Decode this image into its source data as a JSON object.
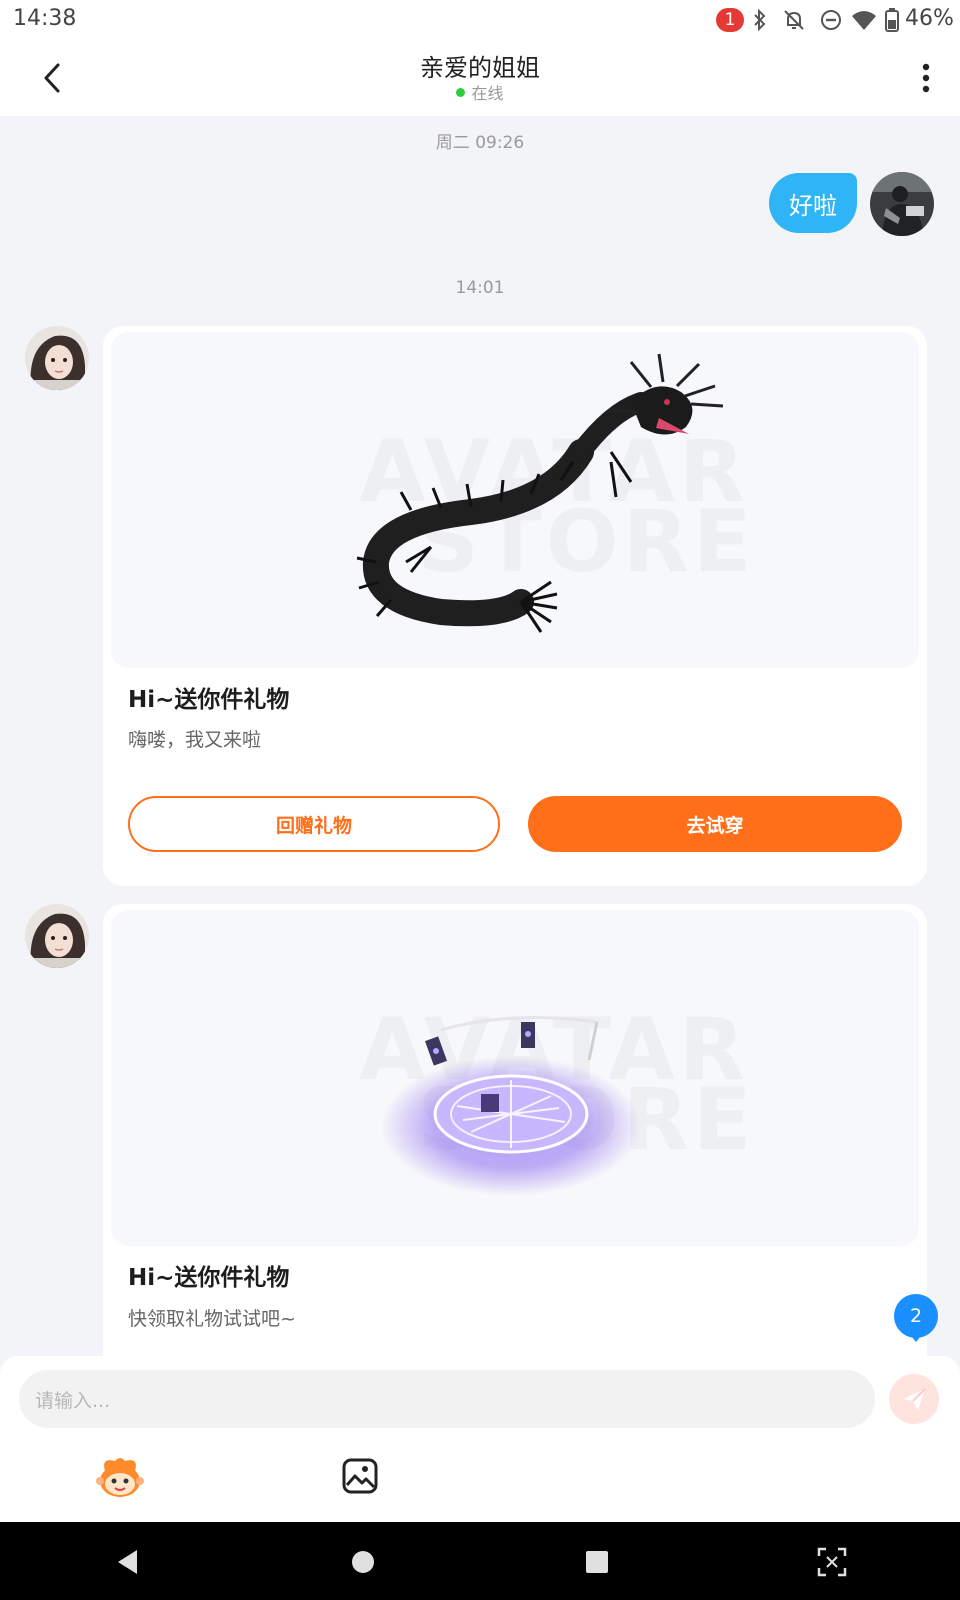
{
  "status_bar": {
    "time": "14:38",
    "notification_count": "1",
    "battery": "46%",
    "icons": [
      "bluetooth-icon",
      "bell-off-icon",
      "do-not-disturb-icon",
      "wifi-icon",
      "battery-icon"
    ]
  },
  "header": {
    "title": "亲爱的姐姐",
    "status": "在线"
  },
  "messages": {
    "timestamp_1": "周二 09:26",
    "outgoing_text": "好啦",
    "timestamp_2": "14:01",
    "cards": [
      {
        "title": "Hi~送你件礼物",
        "subtitle": "嗨喽，我又来啦",
        "return_gift_label": "回赠礼物",
        "try_on_label": "去试穿",
        "watermark": [
          "AVATAR",
          "STORE"
        ]
      },
      {
        "title": "Hi~送你件礼物",
        "subtitle": "快领取礼物试试吧~",
        "watermark": [
          "AVATAR",
          "STORE"
        ]
      }
    ]
  },
  "unread_badge": "2",
  "composer": {
    "placeholder": "请输入..."
  },
  "colors": {
    "accent_orange": "#ff6f1a",
    "bubble_blue": "#2fb5f5",
    "badge_blue": "#1a8fff",
    "online_green": "#2ecc40"
  }
}
